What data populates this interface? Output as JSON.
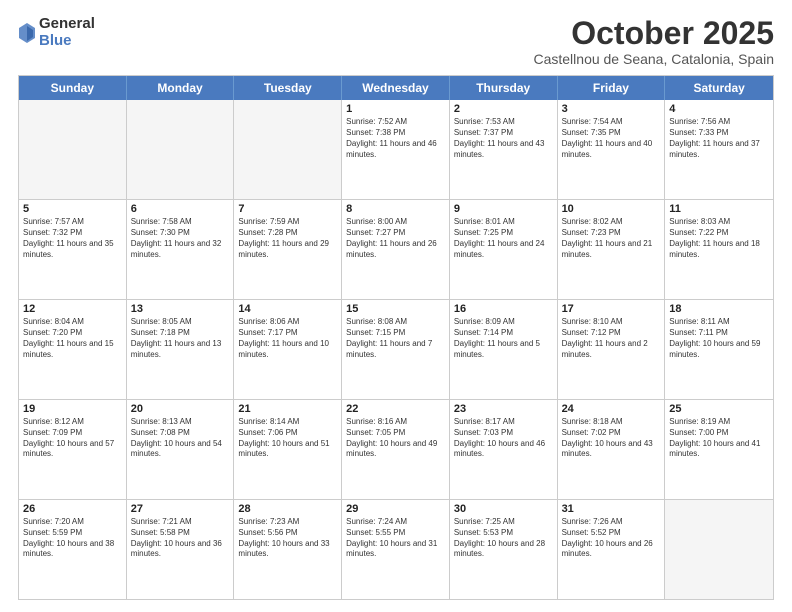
{
  "logo": {
    "general": "General",
    "blue": "Blue"
  },
  "header": {
    "month": "October 2025",
    "location": "Castellnou de Seana, Catalonia, Spain"
  },
  "weekdays": [
    "Sunday",
    "Monday",
    "Tuesday",
    "Wednesday",
    "Thursday",
    "Friday",
    "Saturday"
  ],
  "rows": [
    [
      {
        "day": "",
        "info": "",
        "empty": true
      },
      {
        "day": "",
        "info": "",
        "empty": true
      },
      {
        "day": "",
        "info": "",
        "empty": true
      },
      {
        "day": "1",
        "info": "Sunrise: 7:52 AM\nSunset: 7:38 PM\nDaylight: 11 hours and 46 minutes."
      },
      {
        "day": "2",
        "info": "Sunrise: 7:53 AM\nSunset: 7:37 PM\nDaylight: 11 hours and 43 minutes."
      },
      {
        "day": "3",
        "info": "Sunrise: 7:54 AM\nSunset: 7:35 PM\nDaylight: 11 hours and 40 minutes."
      },
      {
        "day": "4",
        "info": "Sunrise: 7:56 AM\nSunset: 7:33 PM\nDaylight: 11 hours and 37 minutes."
      }
    ],
    [
      {
        "day": "5",
        "info": "Sunrise: 7:57 AM\nSunset: 7:32 PM\nDaylight: 11 hours and 35 minutes."
      },
      {
        "day": "6",
        "info": "Sunrise: 7:58 AM\nSunset: 7:30 PM\nDaylight: 11 hours and 32 minutes."
      },
      {
        "day": "7",
        "info": "Sunrise: 7:59 AM\nSunset: 7:28 PM\nDaylight: 11 hours and 29 minutes."
      },
      {
        "day": "8",
        "info": "Sunrise: 8:00 AM\nSunset: 7:27 PM\nDaylight: 11 hours and 26 minutes."
      },
      {
        "day": "9",
        "info": "Sunrise: 8:01 AM\nSunset: 7:25 PM\nDaylight: 11 hours and 24 minutes."
      },
      {
        "day": "10",
        "info": "Sunrise: 8:02 AM\nSunset: 7:23 PM\nDaylight: 11 hours and 21 minutes."
      },
      {
        "day": "11",
        "info": "Sunrise: 8:03 AM\nSunset: 7:22 PM\nDaylight: 11 hours and 18 minutes."
      }
    ],
    [
      {
        "day": "12",
        "info": "Sunrise: 8:04 AM\nSunset: 7:20 PM\nDaylight: 11 hours and 15 minutes."
      },
      {
        "day": "13",
        "info": "Sunrise: 8:05 AM\nSunset: 7:18 PM\nDaylight: 11 hours and 13 minutes."
      },
      {
        "day": "14",
        "info": "Sunrise: 8:06 AM\nSunset: 7:17 PM\nDaylight: 11 hours and 10 minutes."
      },
      {
        "day": "15",
        "info": "Sunrise: 8:08 AM\nSunset: 7:15 PM\nDaylight: 11 hours and 7 minutes."
      },
      {
        "day": "16",
        "info": "Sunrise: 8:09 AM\nSunset: 7:14 PM\nDaylight: 11 hours and 5 minutes."
      },
      {
        "day": "17",
        "info": "Sunrise: 8:10 AM\nSunset: 7:12 PM\nDaylight: 11 hours and 2 minutes."
      },
      {
        "day": "18",
        "info": "Sunrise: 8:11 AM\nSunset: 7:11 PM\nDaylight: 10 hours and 59 minutes."
      }
    ],
    [
      {
        "day": "19",
        "info": "Sunrise: 8:12 AM\nSunset: 7:09 PM\nDaylight: 10 hours and 57 minutes."
      },
      {
        "day": "20",
        "info": "Sunrise: 8:13 AM\nSunset: 7:08 PM\nDaylight: 10 hours and 54 minutes."
      },
      {
        "day": "21",
        "info": "Sunrise: 8:14 AM\nSunset: 7:06 PM\nDaylight: 10 hours and 51 minutes."
      },
      {
        "day": "22",
        "info": "Sunrise: 8:16 AM\nSunset: 7:05 PM\nDaylight: 10 hours and 49 minutes."
      },
      {
        "day": "23",
        "info": "Sunrise: 8:17 AM\nSunset: 7:03 PM\nDaylight: 10 hours and 46 minutes."
      },
      {
        "day": "24",
        "info": "Sunrise: 8:18 AM\nSunset: 7:02 PM\nDaylight: 10 hours and 43 minutes."
      },
      {
        "day": "25",
        "info": "Sunrise: 8:19 AM\nSunset: 7:00 PM\nDaylight: 10 hours and 41 minutes."
      }
    ],
    [
      {
        "day": "26",
        "info": "Sunrise: 7:20 AM\nSunset: 5:59 PM\nDaylight: 10 hours and 38 minutes."
      },
      {
        "day": "27",
        "info": "Sunrise: 7:21 AM\nSunset: 5:58 PM\nDaylight: 10 hours and 36 minutes."
      },
      {
        "day": "28",
        "info": "Sunrise: 7:23 AM\nSunset: 5:56 PM\nDaylight: 10 hours and 33 minutes."
      },
      {
        "day": "29",
        "info": "Sunrise: 7:24 AM\nSunset: 5:55 PM\nDaylight: 10 hours and 31 minutes."
      },
      {
        "day": "30",
        "info": "Sunrise: 7:25 AM\nSunset: 5:53 PM\nDaylight: 10 hours and 28 minutes."
      },
      {
        "day": "31",
        "info": "Sunrise: 7:26 AM\nSunset: 5:52 PM\nDaylight: 10 hours and 26 minutes."
      },
      {
        "day": "",
        "info": "",
        "empty": true
      }
    ]
  ]
}
